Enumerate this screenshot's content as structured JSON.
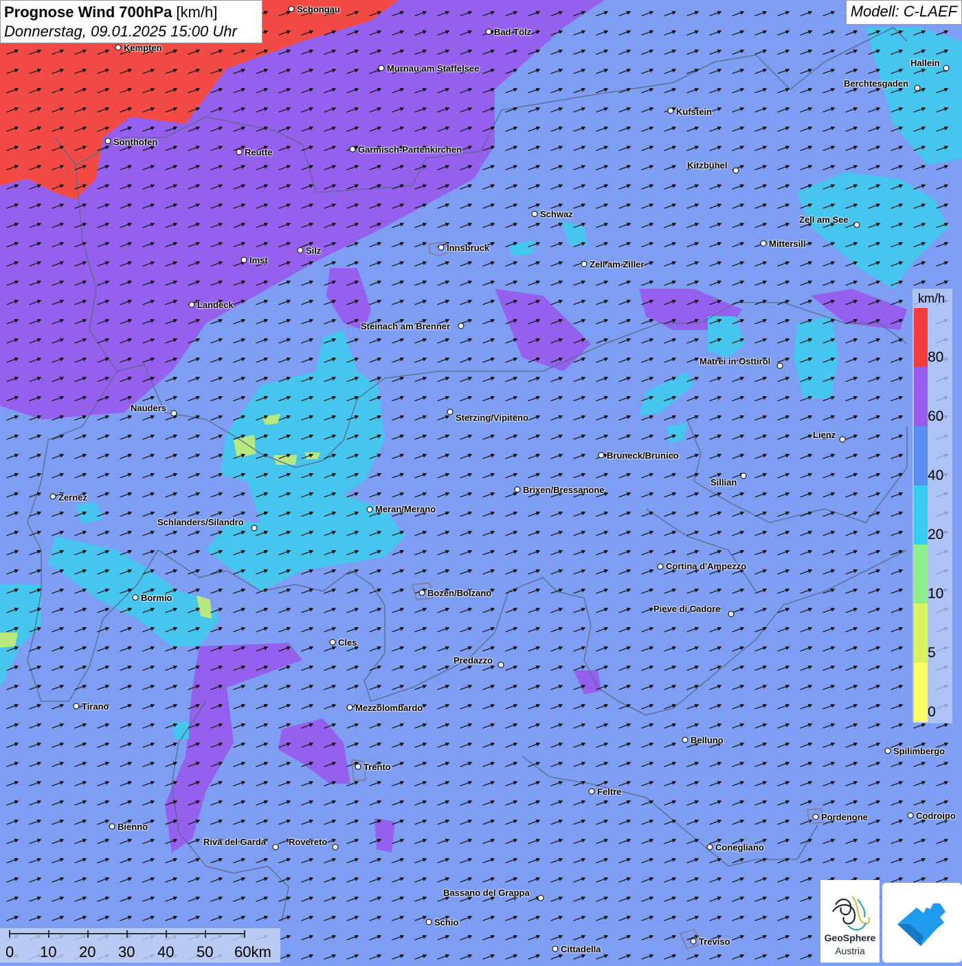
{
  "header": {
    "title_bold": "Prognose Wind 700hPa",
    "title_unit": " [km/h]",
    "date": "Donnerstag, 09.01.2025 15:00 Uhr",
    "model": "Modell: C-LAEF"
  },
  "legend": {
    "unit": "km/h",
    "colors": [
      "#ffff66",
      "#d8f560",
      "#8df08a",
      "#35ccf0",
      "#5a8df0",
      "#9a5cf0",
      "#f43c3c"
    ],
    "labels": [
      "0",
      "5",
      "10",
      "20",
      "40",
      "60",
      "80"
    ]
  },
  "scale": {
    "labels": [
      "0",
      "10",
      "20",
      "30",
      "40",
      "50",
      "60km"
    ]
  },
  "logos": {
    "geosphere_line1": "GeoSphere",
    "geosphere_line2": "Austria"
  },
  "cities": [
    {
      "name": "Schongau"
    },
    {
      "name": "Bad Tölz"
    },
    {
      "name": "Kempten"
    },
    {
      "name": "Murnau am Staffelsee"
    },
    {
      "name": "Hallein"
    },
    {
      "name": "Berchtesgaden"
    },
    {
      "name": "Kufstein"
    },
    {
      "name": "Sonthofen"
    },
    {
      "name": "Reutte"
    },
    {
      "name": "Garmisch-Partenkirchen"
    },
    {
      "name": "Kitzbühel"
    },
    {
      "name": "Schwaz"
    },
    {
      "name": "Zell am See"
    },
    {
      "name": "Mittersill"
    },
    {
      "name": "Innsbruck"
    },
    {
      "name": "Silz"
    },
    {
      "name": "Imst"
    },
    {
      "name": "Zell am Ziller"
    },
    {
      "name": "Landeck"
    },
    {
      "name": "Steinach am Brenner"
    },
    {
      "name": "Matrei in Osttirol"
    },
    {
      "name": "Nauders"
    },
    {
      "name": "Sterzing/Vipiteno"
    },
    {
      "name": "Lienz"
    },
    {
      "name": "Bruneck/Brunico"
    },
    {
      "name": "Sillian"
    },
    {
      "name": "Zernez"
    },
    {
      "name": "Brixen/Bressanone"
    },
    {
      "name": "Meran/Merano"
    },
    {
      "name": "Schlanders/Silandro"
    },
    {
      "name": "Cortina d'Ampezzo"
    },
    {
      "name": "Bozen/Bolzano"
    },
    {
      "name": "Bormio"
    },
    {
      "name": "Pieve di Cadore"
    },
    {
      "name": "Cles"
    },
    {
      "name": "Predazzo"
    },
    {
      "name": "Tirano"
    },
    {
      "name": "Mezzolombardo"
    },
    {
      "name": "Belluno"
    },
    {
      "name": "Spilimbergo"
    },
    {
      "name": "Trento"
    },
    {
      "name": "Feltre"
    },
    {
      "name": "Pordenone"
    },
    {
      "name": "Codroipo"
    },
    {
      "name": "Bienno"
    },
    {
      "name": "Riva del Garda"
    },
    {
      "name": "Rovereto"
    },
    {
      "name": "Conegliano"
    },
    {
      "name": "Bassano del Grappa"
    },
    {
      "name": "Schio"
    },
    {
      "name": "Treviso"
    },
    {
      "name": "Cittadella"
    }
  ]
}
